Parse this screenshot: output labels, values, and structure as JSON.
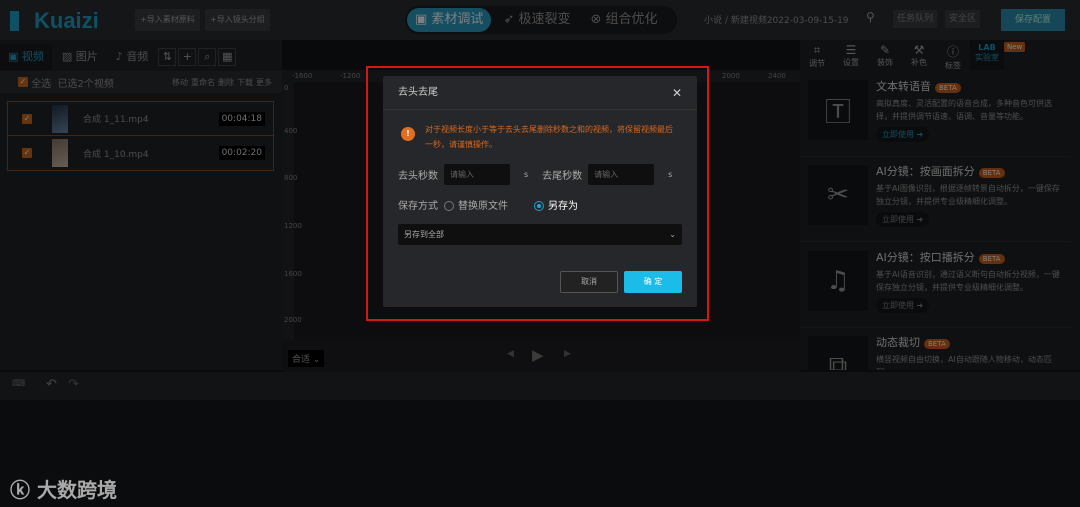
{
  "app": {
    "logo": "Kuaizi",
    "import_material": "+导入素材原料",
    "import_shots": "+导入镜头分组"
  },
  "modes": [
    {
      "label": "素材调试",
      "active": true
    },
    {
      "label": "极速裂变"
    },
    {
      "label": "组合优化"
    }
  ],
  "breadcrumb": {
    "parent": "小说",
    "sep": "/",
    "current": "新建视频2022-03-09-15-19"
  },
  "header": {
    "task_queue": "任务队列",
    "safe_zone": "安全区",
    "save_config": "保存配置"
  },
  "left": {
    "tabs": [
      "视频",
      "图片",
      "音频"
    ],
    "select_all": "全选",
    "selected": "已选2个视频",
    "actions": [
      "移动",
      "重命名",
      "删除",
      "下载",
      "更多"
    ],
    "files": [
      {
        "name": "合成 1_11.mp4",
        "duration": "00:04:18"
      },
      {
        "name": "合成 1_10.mp4",
        "duration": "00:02:20"
      }
    ]
  },
  "canvas": {
    "hruler": [
      "-1600",
      "-1200",
      "2000",
      "2400"
    ],
    "vruler": [
      "0",
      "400",
      "800",
      "1200",
      "1600",
      "2000"
    ],
    "fit": "合适"
  },
  "right": {
    "tabs": [
      "调节",
      "设置",
      "装饰",
      "补色",
      "标签",
      "实验室"
    ],
    "new_badge": "New",
    "cards": [
      {
        "title": "文本转语音",
        "badge": "BETA",
        "desc": "高拟真度、灵活配置的语音合成，多种音色可供选择，并提供调节语速、语调、音量等功能。",
        "action": "立即使用"
      },
      {
        "title": "AI分镜：按画面拆分",
        "badge": "BETA",
        "desc": "基于AI图像识别，根据逐帧转景自动拆分，一键保存独立分镜，并提供专业级精细化调整。",
        "action": "立即使用"
      },
      {
        "title": "AI分镜：按口播拆分",
        "badge": "BETA",
        "desc": "基于AI语音识别，通过语义断句自动拆分视频，一键保存独立分镜，并提供专业级精细化调整。",
        "action": "立即使用"
      },
      {
        "title": "动态裁切",
        "badge": "BETA",
        "desc": "横竖视频自由切换，AI自动跟随人物移动，动态匹配…",
        "action": ""
      }
    ]
  },
  "dialog": {
    "title": "去头去尾",
    "warning": "对于视频长度小于等于去头去尾删除秒数之和的视频，将保留视频最后一秒，请谨慎操作。",
    "head_label": "去头秒数",
    "tail_label": "去尾秒数",
    "placeholder": "请输入",
    "unit": "s",
    "save_label": "保存方式",
    "opt_replace": "替换原文件",
    "opt_saveas": "另存为",
    "select_value": "另存到全部",
    "cancel": "取消",
    "ok": "确 定"
  },
  "watermark": "大数跨境"
}
